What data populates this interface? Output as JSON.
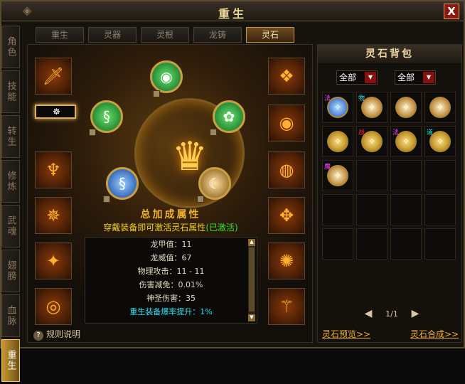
{
  "window": {
    "title": "重生",
    "close_label": "X"
  },
  "side_tabs": [
    {
      "label": "角色",
      "active": false
    },
    {
      "label": "技能",
      "active": false
    },
    {
      "label": "转生",
      "active": false
    },
    {
      "label": "修炼",
      "active": false
    },
    {
      "label": "武魂",
      "active": false
    },
    {
      "label": "翅膀",
      "active": false
    },
    {
      "label": "血脉",
      "active": false
    },
    {
      "label": "重生",
      "active": true
    }
  ],
  "top_tabs": [
    {
      "label": "重生",
      "active": false
    },
    {
      "label": "灵器",
      "active": false
    },
    {
      "label": "灵根",
      "active": false
    },
    {
      "label": "龙铸",
      "active": false
    },
    {
      "label": "灵石",
      "active": true
    }
  ],
  "equipment": {
    "left_slots": [
      "sword-icon",
      "helmet-icon",
      "armor-icon",
      "belt-icon",
      "boots-icon",
      "ring-icon"
    ],
    "right_slots": [
      "necklace-icon",
      "bracelet-icon",
      "ring-icon",
      "gloves-icon",
      "shoulder-icon",
      "wand-icon"
    ]
  },
  "summary": {
    "title": "总加成属性",
    "subtitle": "穿戴装备即可激活灵石属性",
    "activated": "(已激活)",
    "stats": [
      {
        "label": "龙甲值：11"
      },
      {
        "label": "龙威值：67"
      },
      {
        "label": "物理攻击：11 - 11"
      },
      {
        "label": "伤害减免：0.01%"
      },
      {
        "label": "神圣伤害：35"
      },
      {
        "label": "重生装备爆率提升：1%"
      }
    ]
  },
  "help_label": "规则说明",
  "bag": {
    "title": "灵石背包",
    "filter1": "全部",
    "filter2": "全部",
    "items": [
      {
        "tag": "法",
        "tag_color": "#ff40ff",
        "type": "blue"
      },
      {
        "tag": "物",
        "tag_color": "#30e0f0",
        "type": "amber"
      },
      {
        "tag": "",
        "tag_color": "",
        "type": "amber"
      },
      {
        "tag": "",
        "tag_color": "",
        "type": "amber"
      },
      {
        "tag": "",
        "tag_color": "",
        "type": "gold"
      },
      {
        "tag": "战",
        "tag_color": "#ff3030",
        "type": "gold"
      },
      {
        "tag": "法",
        "tag_color": "#ff40ff",
        "type": "gold"
      },
      {
        "tag": "道",
        "tag_color": "#30e0f0",
        "type": "gold"
      },
      {
        "tag": "魔",
        "tag_color": "#ff40ff",
        "type": "amber"
      }
    ],
    "page": "1/1",
    "link_preview": "灵石预览>>",
    "link_combine": "灵石合成>>"
  }
}
